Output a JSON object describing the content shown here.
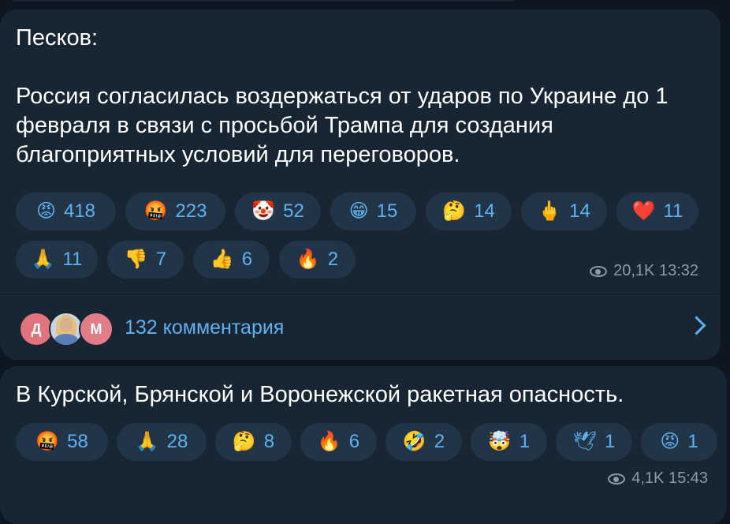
{
  "post1": {
    "text": "Песков:\n\nРоссия согласилась воздержаться от ударов по Украине до 1 февраля в связи с просьбой Трампа для создания благоприятных условий для переговоров.",
    "reactions_row1": [
      {
        "emoji": "😡",
        "icon": "angry-face-icon",
        "count": "418"
      },
      {
        "emoji": "🤬",
        "icon": "cursing-face-icon",
        "count": "223"
      },
      {
        "emoji": "🤡",
        "icon": "clown-face-icon",
        "count": "52"
      },
      {
        "emoji": "😁",
        "icon": "grinning-face-icon",
        "count": "15"
      },
      {
        "emoji": "🤔",
        "icon": "thinking-face-icon",
        "count": "14"
      },
      {
        "emoji": "🖕",
        "icon": "middle-finger-icon",
        "count": "14"
      },
      {
        "emoji": "❤️",
        "icon": "heart-icon",
        "count": "11"
      }
    ],
    "reactions_row2": [
      {
        "emoji": "🙏",
        "icon": "folded-hands-icon",
        "count": "11"
      },
      {
        "emoji": "👎",
        "icon": "thumbs-down-icon",
        "count": "7"
      },
      {
        "emoji": "👍",
        "icon": "thumbs-up-icon",
        "count": "6"
      },
      {
        "emoji": "🔥",
        "icon": "fire-icon",
        "count": "2"
      }
    ],
    "views_time": "20,1K 13:32",
    "comments": {
      "avatar_letters": [
        "Д",
        "М"
      ],
      "label": "132 комментария"
    }
  },
  "post2": {
    "text": "В Курской, Брянской и Воронежской ракетная опасность.",
    "reactions": [
      {
        "emoji": "🤬",
        "icon": "cursing-face-icon",
        "count": "58"
      },
      {
        "emoji": "🙏",
        "icon": "folded-hands-icon",
        "count": "28"
      },
      {
        "emoji": "🤔",
        "icon": "thinking-face-icon",
        "count": "8"
      },
      {
        "emoji": "🔥",
        "icon": "fire-icon",
        "count": "6"
      },
      {
        "emoji": "🤣",
        "icon": "rolling-laughing-icon",
        "count": "2"
      },
      {
        "emoji": "🤯",
        "icon": "exploding-head-icon",
        "count": "1"
      },
      {
        "emoji": "🕊",
        "icon": "dove-icon",
        "count": "1"
      },
      {
        "emoji": "😡",
        "icon": "angry-face-icon",
        "count": "1"
      }
    ],
    "views_time": "4,1K 15:43"
  },
  "colors": {
    "background": "#0e1621",
    "bubble": "#182533",
    "pill": "#223447",
    "accent": "#5fb2f0",
    "meta": "#8b99a8"
  }
}
